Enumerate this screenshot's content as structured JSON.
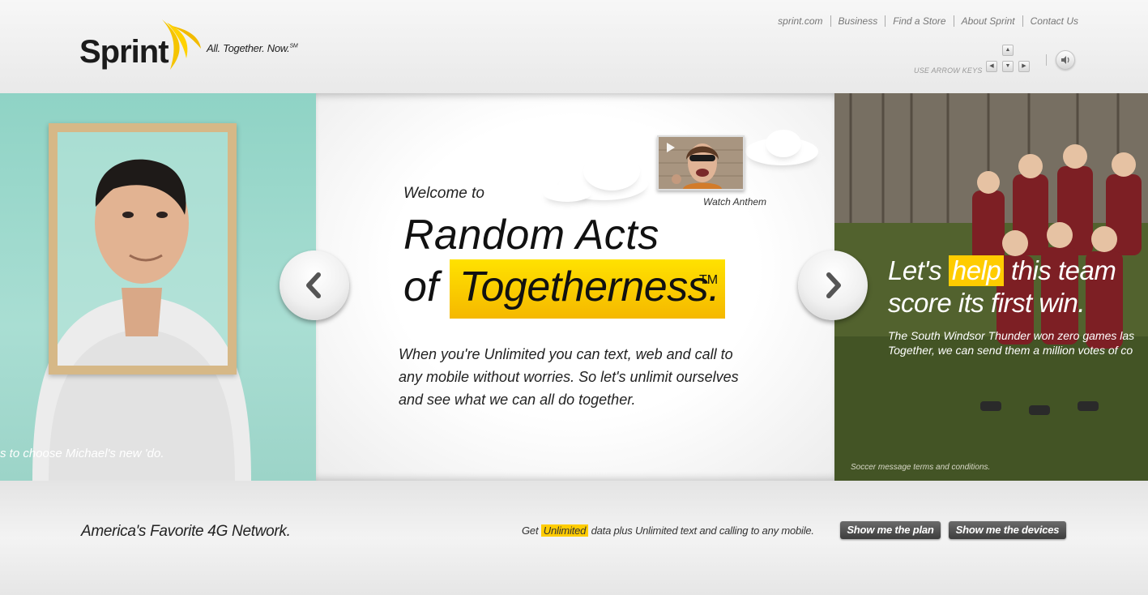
{
  "header": {
    "logo_text": "Sprint",
    "tagline": "All. Together. Now.",
    "tagline_mark": "SM",
    "nav": [
      "sprint.com",
      "Business",
      "Find a Store",
      "About Sprint",
      "Contact Us"
    ],
    "arrow_hint": "USE ARROW KEYS"
  },
  "carousel": {
    "left": {
      "caption": "s to choose Michael's new 'do."
    },
    "center": {
      "welcome": "Welcome to",
      "headline_line1": "Random Acts",
      "headline_of": "of",
      "headline_highlight": "Togetherness.",
      "trademark": "TM",
      "body": "When you're Unlimited you can text, web and call to any mobile without worries. So let's unlimit ourselves and see what we can all do together.",
      "video_label": "Watch Anthem"
    },
    "right": {
      "headline_pre": "Let's",
      "headline_highlight": "help",
      "headline_post": "this team",
      "headline_line2": "score its first win.",
      "body_line1": "The South Windsor Thunder won zero games las",
      "body_line2": "Together, we can send them a million votes of co",
      "terms": "Soccer message terms and conditions."
    }
  },
  "footer": {
    "slogan": "America's Favorite 4G Network.",
    "promo_pre": "Get",
    "promo_highlight": "Unlimited",
    "promo_post": "data plus Unlimited text and calling to any mobile.",
    "button_plan": "Show me the plan",
    "button_devices": "Show me the devices"
  },
  "colors": {
    "brand_yellow": "#ffcc00",
    "teal_panel": "#a9ded3",
    "button_dark": "#4a4a4a"
  },
  "icons": [
    "sprint-wing-icon",
    "arrow-up-icon",
    "arrow-left-icon",
    "arrow-down-icon",
    "arrow-right-icon",
    "speaker-icon",
    "play-icon",
    "chevron-left-icon",
    "chevron-right-icon"
  ]
}
